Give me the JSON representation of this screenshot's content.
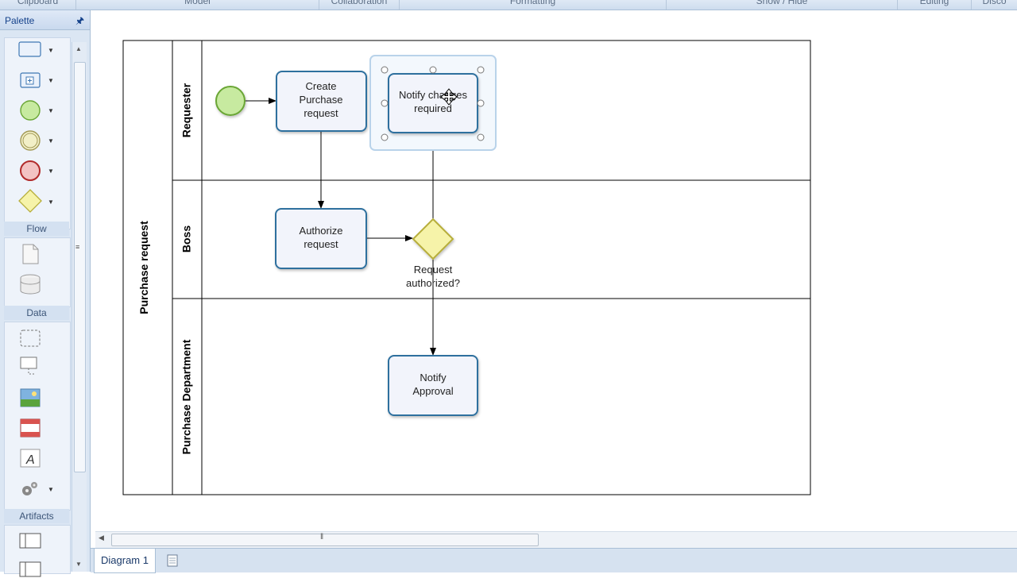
{
  "ribbon": {
    "groups": [
      "Clipboard",
      "Model",
      "Collaboration",
      "Formatting",
      "Show / Hide",
      "Editing",
      "Disco"
    ]
  },
  "palette": {
    "title": "Palette",
    "sections": {
      "flow": "Flow",
      "data": "Data",
      "artifacts": "Artifacts"
    }
  },
  "diagram": {
    "pool": "Purchase request",
    "lanes": [
      "Requester",
      "Boss",
      "Purchase Department"
    ],
    "tasks": {
      "create": [
        "Create",
        "Purchase",
        "request"
      ],
      "notify_changes": [
        "Notify changes",
        "required"
      ],
      "authorize": [
        "Authorize",
        "request"
      ],
      "notify_approval": [
        "Notify",
        "Approval"
      ]
    },
    "gateway_label": [
      "Request",
      "authorized?"
    ]
  },
  "tabs": {
    "diagram1": "Diagram 1"
  },
  "colors": {
    "task_border": "#2e6f9e",
    "task_fill": "#f2f4fb",
    "start_event": "#b6e08a",
    "gateway": "#f6f3a9",
    "selection": "#b9d3ea"
  }
}
